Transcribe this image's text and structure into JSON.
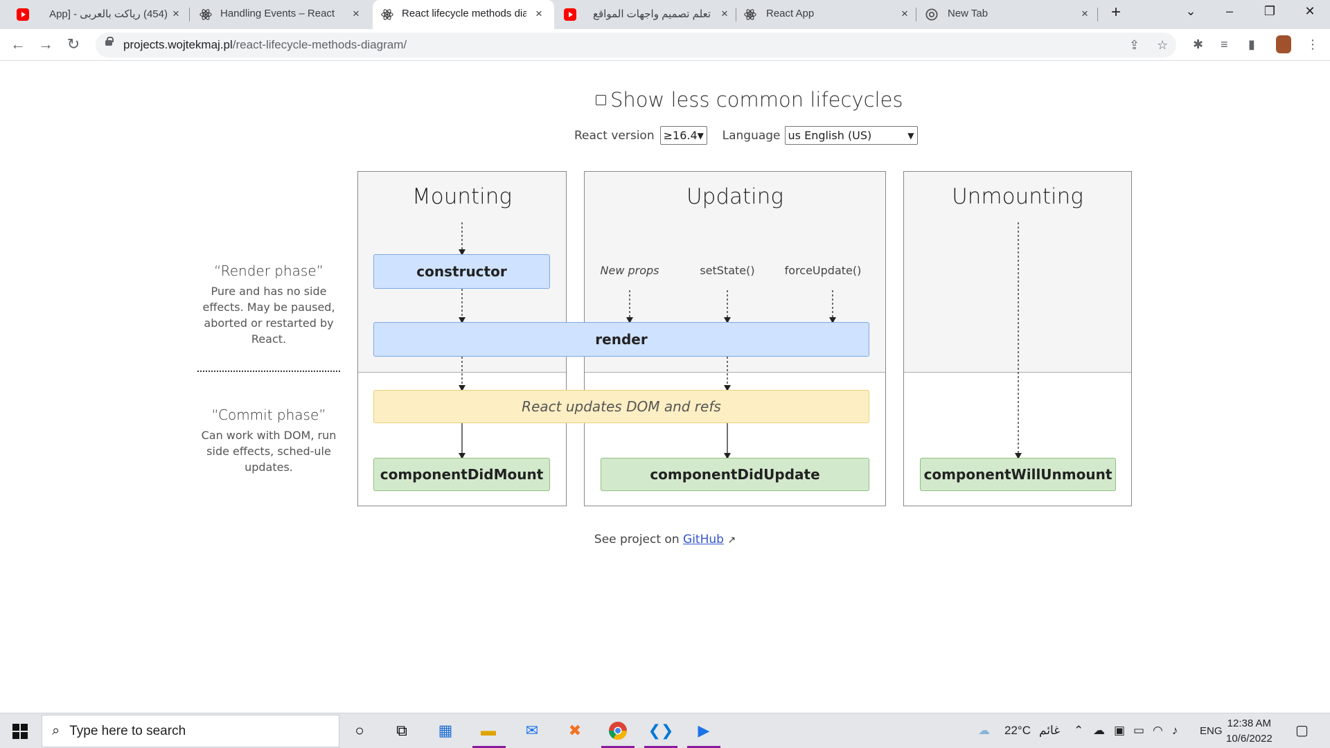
{
  "browser": {
    "tabs": [
      {
        "title": "(454) رياكت بالعربى - [App",
        "favicon": "youtube-icon"
      },
      {
        "title": "Handling Events – React",
        "favicon": "react-icon"
      },
      {
        "title": "React lifecycle methods dia",
        "favicon": "react-icon",
        "active": true
      },
      {
        "title": "تعلم تصميم واجهات المواقع",
        "favicon": "youtube-icon"
      },
      {
        "title": "React App",
        "favicon": "react-icon"
      },
      {
        "title": "New Tab",
        "favicon": "chrome-icon"
      }
    ],
    "close_glyph": "×",
    "new_tab_glyph": "+",
    "url_host": "projects.wojtekmaj.pl",
    "url_path": "/react-lifecycle-methods-diagram/"
  },
  "page": {
    "show_less_common_label": "Show less common lifecycles",
    "react_version_label": "React version",
    "react_version_value": "≥16.4",
    "language_label": "Language",
    "language_value": "us English (US)",
    "columns": {
      "mounting": "Mounting",
      "updating": "Updating",
      "unmounting": "Unmounting"
    },
    "methods": {
      "constructor": "constructor",
      "render": "render",
      "dom_update": "React updates DOM and refs",
      "did_mount": "componentDidMount",
      "did_update": "componentDidUpdate",
      "will_unmount": "componentWillUnmount"
    },
    "triggers": {
      "new_props": "New props",
      "set_state": "setState()",
      "force_update": "forceUpdate()"
    },
    "render_phase": {
      "title": "“Render phase”",
      "desc": "Pure and has no side effects. May be paused, aborted or restarted by React."
    },
    "commit_phase": {
      "title": "“Commit phase”",
      "desc": "Can work with DOM, run side effects, sched-ule updates."
    },
    "footer_text": "See project on",
    "footer_link": "GitHub"
  },
  "taskbar": {
    "search_placeholder": "Type here to search",
    "weather": "22°C",
    "weather_desc": "غائم",
    "lang": "ENG",
    "time": "12:38 AM",
    "date": "10/6/2022"
  },
  "colors": {
    "blue_box": "#cfe2ff",
    "green_box": "#d3e9cc",
    "yellow_box": "#fdefc3",
    "link": "#3355cc"
  }
}
